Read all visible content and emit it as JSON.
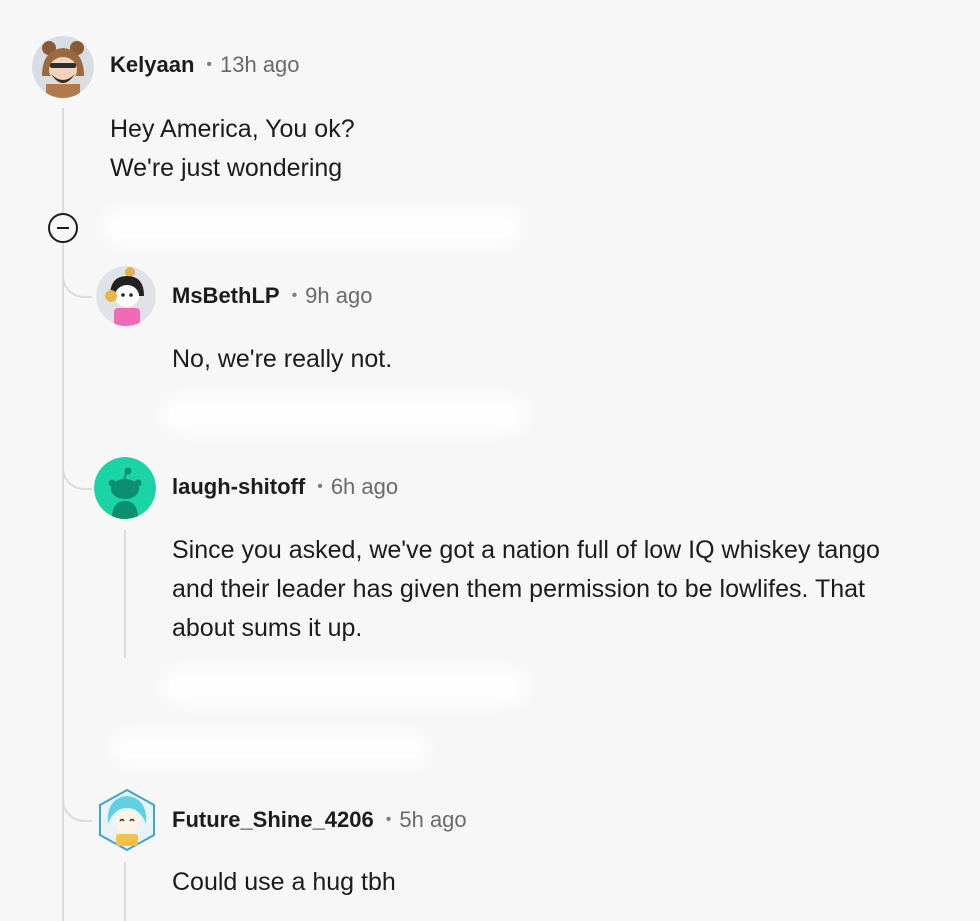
{
  "comments": [
    {
      "username": "Kelyaan",
      "dot": "•",
      "time": "13h ago",
      "lines": [
        "Hey America, You ok?",
        "We're just wondering"
      ]
    },
    {
      "username": "MsBethLP",
      "dot": "•",
      "time": "9h ago",
      "lines": [
        "No, we're really not."
      ]
    },
    {
      "username": "laugh-shitoff",
      "dot": "•",
      "time": "6h ago",
      "lines": [
        "Since you asked, we've got a nation full of low IQ whiskey tango",
        "and their leader has given them permission to be lowlifes. That",
        "about sums it up."
      ]
    },
    {
      "username": "Future_Shine_4206",
      "dot": "•",
      "time": "5h ago",
      "lines": [
        "Could use a hug tbh"
      ]
    }
  ],
  "icons": {
    "collapse": "minus-circle-icon"
  },
  "colors": {
    "background": "#f7f7f7",
    "thread_line": "#dcdcdc",
    "snoo_teal": "#1bd4a5"
  }
}
